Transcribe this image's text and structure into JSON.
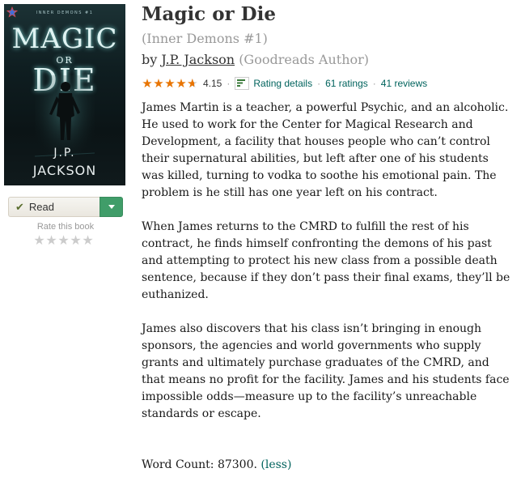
{
  "cover": {
    "series_line": "INNER DEMONS #1",
    "title_line1": "MAGIC",
    "title_line2": "OR",
    "title_line3": "DIE",
    "author_line1": "J.P.",
    "author_line2": "JACKSON"
  },
  "shelf": {
    "status_label": "Read",
    "rate_label": "Rate this book",
    "user_rating_stars": 0
  },
  "book": {
    "title": "Magic or Die",
    "series": "(Inner Demons #1)",
    "by": "by",
    "author": "J.P. Jackson",
    "author_role": "(Goodreads Author)"
  },
  "rating": {
    "average": "4.15",
    "average_value": 4.15,
    "details_label": "Rating details",
    "ratings_count": "61 ratings",
    "reviews_count": "41 reviews",
    "star_color": "#e87400",
    "link_color": "#00635d"
  },
  "description": {
    "paragraphs": [
      "James Martin is a teacher, a powerful Psychic, and an alcoholic. He used to work for the Center for Magical Research and Development, a facility that houses people who can’t control their supernatural abilities, but left after one of his students was killed, turning to vodka to soothe his emotional pain. The problem is he still has one year left on his contract.",
      "When James returns to the CMRD to fulfill the rest of his contract, he finds himself confronting the demons of his past and attempting to protect his new class from a possible death sentence, because if they don’t pass their final exams, they’ll be euthanized.",
      "James also discovers that his class isn’t bringing in enough sponsors, the agencies and world governments who supply grants and ultimately purchase graduates of the CMRD, and that means no profit for the facility. James and his students face impossible odds—measure up to the facility’s unreachable standards or escape."
    ],
    "word_count": "Word Count: 87300.",
    "less_label": "(less)"
  }
}
